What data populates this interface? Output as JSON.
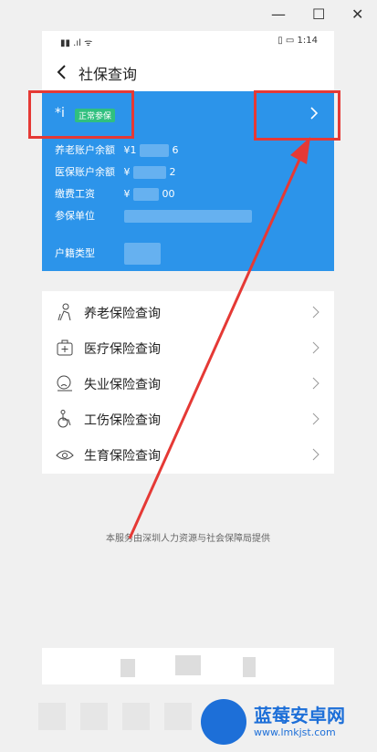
{
  "window": {
    "min_icon": "minimize-icon",
    "max_icon": "maximize-icon",
    "close_icon": "close-icon",
    "min": "—",
    "max": "☐",
    "close": "✕"
  },
  "status_bar": {
    "left": "▮▮ .ıl ᯤ",
    "right": "▯ ▭ 1:14"
  },
  "header": {
    "title": "社保查询"
  },
  "card": {
    "name": "*i",
    "badge": "正常参保",
    "rows": [
      {
        "label": "养老账户余额",
        "value_start": "¥1",
        "value_end": "6"
      },
      {
        "label": "医保账户余额",
        "value_start": "¥",
        "value_end": "2"
      },
      {
        "label": "缴费工资",
        "value_start": "¥",
        "value_end": "00"
      },
      {
        "label": "参保单位",
        "value_start": "",
        "value_end": ""
      },
      {
        "label": "户籍类型",
        "value_start": "",
        "value_end": ""
      }
    ]
  },
  "menu": {
    "items": [
      {
        "label": "养老保险查询",
        "icon": "elderly-icon"
      },
      {
        "label": "医疗保险查询",
        "icon": "medical-kit-icon"
      },
      {
        "label": "失业保险查询",
        "icon": "unemployment-icon"
      },
      {
        "label": "工伤保险查询",
        "icon": "wheelchair-icon"
      },
      {
        "label": "生育保险查询",
        "icon": "maternity-icon"
      }
    ]
  },
  "footer": {
    "note": "本服务由深圳人力资源与社会保障局提供"
  },
  "watermark": {
    "brand": "蓝莓安卓网",
    "url": "www.lmkjst.com"
  },
  "colors": {
    "card_blue": "#2c94ea",
    "badge_green": "#30c07f",
    "annotation_red": "#e53935"
  }
}
